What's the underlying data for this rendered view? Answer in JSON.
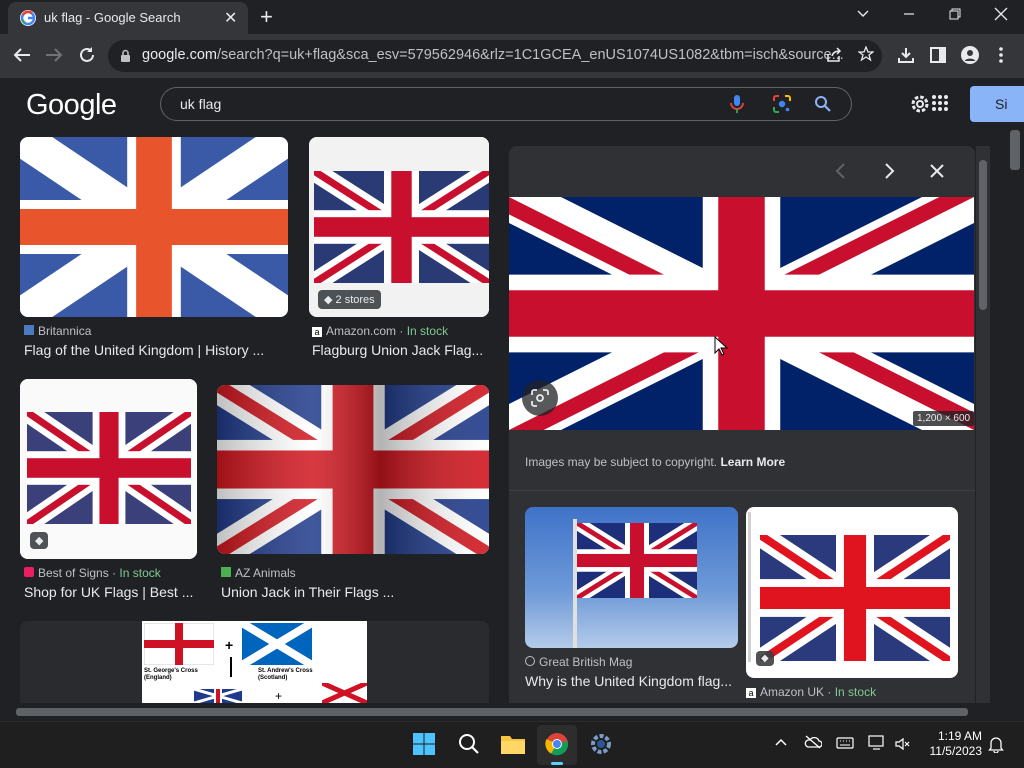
{
  "browser": {
    "tab_title": "uk flag - Google Search",
    "new_tab_label": "+",
    "close_tab_label": "✕",
    "url_domain": "google.com",
    "url_path": "/search?q=uk+flag&sca_esv=579562946&rlz=1C1GCEA_enUS1074US1082&tbm=isch&source..."
  },
  "google": {
    "logo": "Google",
    "query": "uk flag",
    "signin_label": "Si"
  },
  "results": [
    {
      "source": "Britannica",
      "title": "Flag of the United Kingdom | History ..."
    },
    {
      "source": "Amazon.com",
      "stock": "In stock",
      "title": "Flagburg Union Jack Flag...",
      "badge": "2 stores"
    },
    {
      "source": "Best of Signs",
      "stock": "In stock",
      "title": "Shop for UK Flags | Best ..."
    },
    {
      "source": "AZ Animals",
      "title": "Union Jack in Their Flags ..."
    }
  ],
  "diagram": {
    "label1": "St. George's Cross",
    "label1b": "(England)",
    "label2": "St. Andrew's Cross",
    "label2b": "(Scotland)",
    "plus": "+"
  },
  "panel": {
    "image_size": "1,200 × 600",
    "copyright_text": "Images may be subject to copyright.",
    "learn_more": "Learn More",
    "related": [
      {
        "source": "Great British Mag",
        "title": "Why is the United Kingdom flag..."
      },
      {
        "source": "Amazon UK",
        "stock": "In stock"
      }
    ]
  },
  "sep": "·",
  "taskbar": {
    "time": "1:19 AM",
    "date": "11/5/2023"
  },
  "colors": {
    "flag_blue": "#012169",
    "flag_red": "#C8102E",
    "accent": "#8ab4f8"
  }
}
